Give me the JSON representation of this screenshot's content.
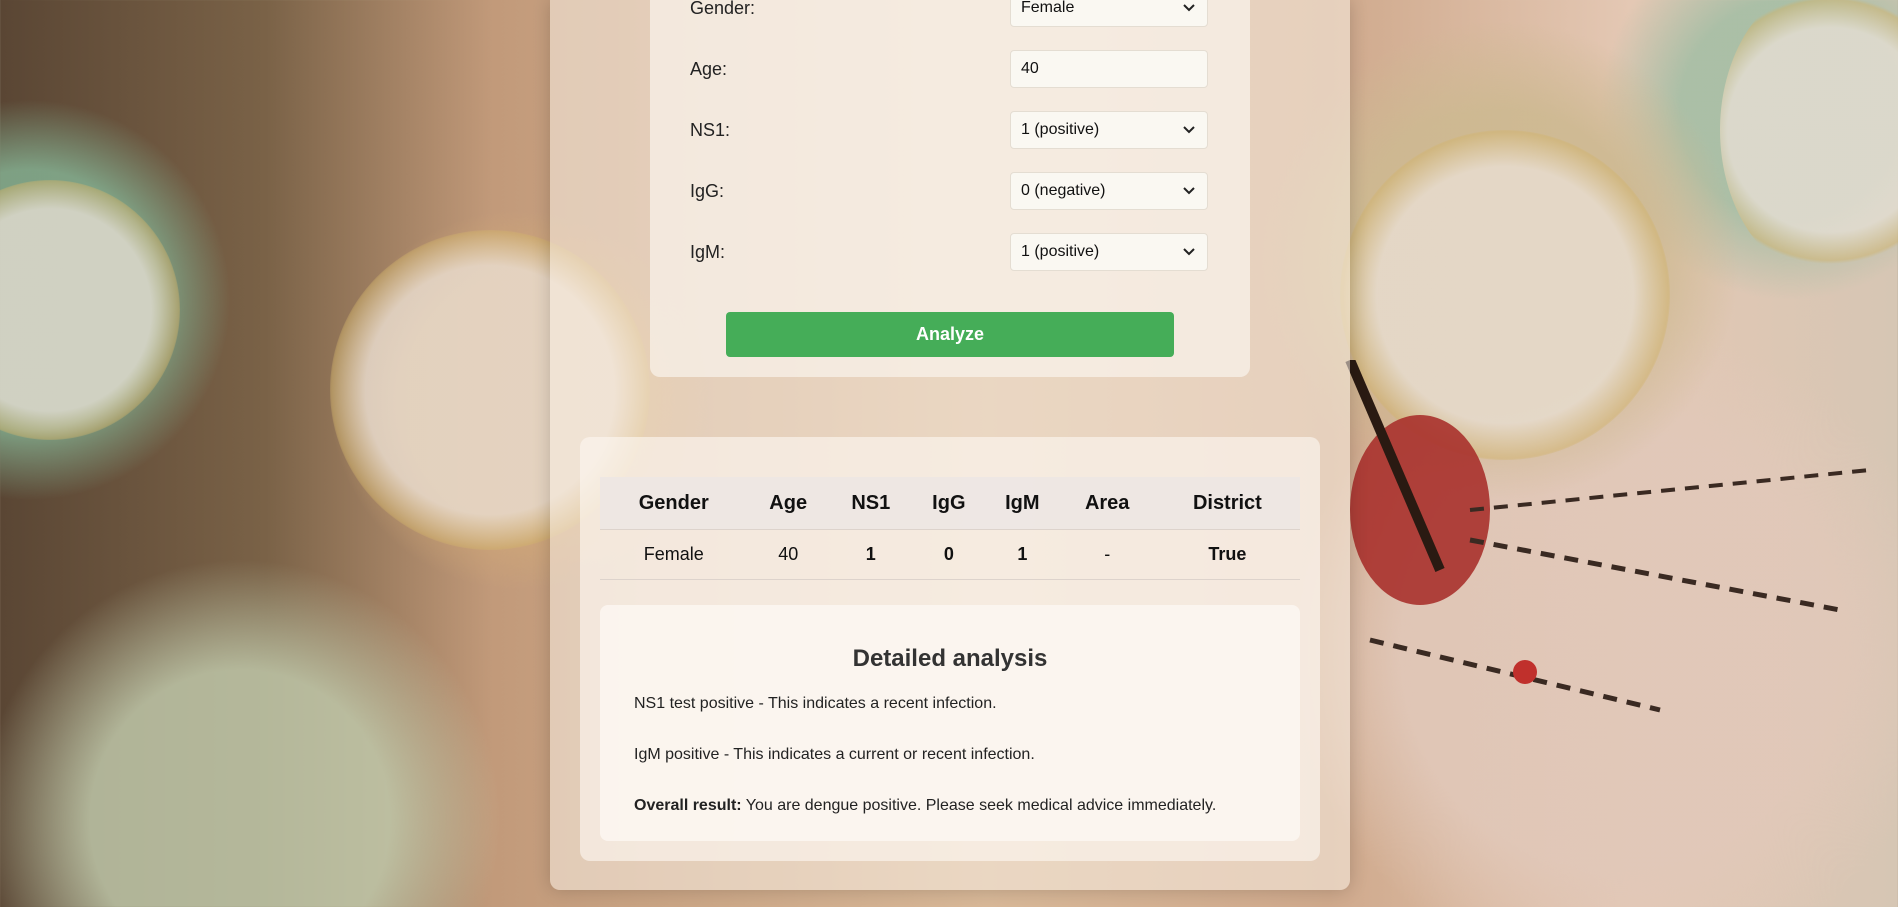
{
  "form": {
    "gender": {
      "label": "Gender:",
      "value": "Female"
    },
    "age": {
      "label": "Age:",
      "value": "40"
    },
    "ns1": {
      "label": "NS1:",
      "value": "1 (positive)"
    },
    "igg": {
      "label": "IgG:",
      "value": "0 (negative)"
    },
    "igm": {
      "label": "IgM:",
      "value": "1 (positive)"
    },
    "analyze_label": "Analyze"
  },
  "results": {
    "headers": [
      "Gender",
      "Age",
      "NS1",
      "IgG",
      "IgM",
      "Area",
      "District"
    ],
    "row": {
      "gender": "Female",
      "age": "40",
      "ns1": "1",
      "igg": "0",
      "igm": "1",
      "area": "-",
      "district": "True"
    }
  },
  "analysis": {
    "title": "Detailed analysis",
    "ns1_text": "NS1 test positive - This indicates a recent infection.",
    "igm_text": "IgM positive - This indicates a current or recent infection.",
    "overall_label": "Overall result:",
    "overall_text": "You are dengue positive. Please seek medical advice immediately."
  },
  "colors": {
    "analyze_button": "#45ad58",
    "positive": "#e0302f",
    "negative": "#2c9a45"
  },
  "icons": {
    "select_chevron": "chevron-down-icon"
  }
}
